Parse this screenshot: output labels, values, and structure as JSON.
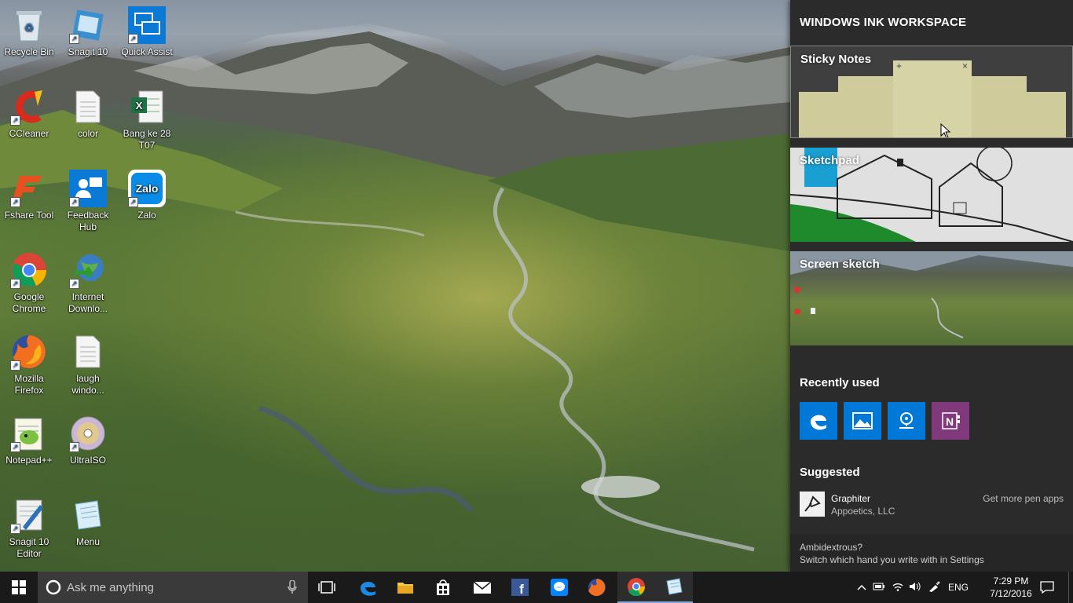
{
  "desktop": {
    "icons": [
      {
        "label": "Recycle Bin"
      },
      {
        "label": "Snagit 10"
      },
      {
        "label": "Quick Assist"
      },
      {
        "label": "CCleaner"
      },
      {
        "label": "color"
      },
      {
        "label": "Bang ke 28 T07"
      },
      {
        "label": "Fshare Tool"
      },
      {
        "label": "Feedback Hub"
      },
      {
        "label": "Zalo"
      },
      {
        "label": "Google Chrome"
      },
      {
        "label": "Internet Downlo..."
      },
      {
        "label": "Mozilla Firefox"
      },
      {
        "label": "laugh windo..."
      },
      {
        "label": "Notepad++"
      },
      {
        "label": "UltraISO"
      },
      {
        "label": "Snagit 10 Editor"
      },
      {
        "label": "Menu"
      }
    ],
    "zalo_text": "Zalo"
  },
  "ink": {
    "title": "WINDOWS INK WORKSPACE",
    "tiles": {
      "sticky": "Sticky Notes",
      "sketchpad": "Sketchpad",
      "screen_sketch": "Screen sketch"
    },
    "note_plus": "+",
    "note_close": "×",
    "recently_used": "Recently used",
    "suggested": "Suggested",
    "suggested_app": {
      "name": "Graphiter",
      "publisher": "Appoetics, LLC"
    },
    "get_more": "Get more pen apps",
    "tip_title": "Ambidextrous?",
    "tip_body": "Switch which hand you write with in Settings",
    "colors": {
      "edge": "#0078d7",
      "photos": "#0078d7",
      "maps": "#0078d7",
      "onenote": "#80397b"
    }
  },
  "taskbar": {
    "search_placeholder": "Ask me anything",
    "language": "ENG",
    "time": "7:29 PM",
    "date": "7/12/2016"
  }
}
